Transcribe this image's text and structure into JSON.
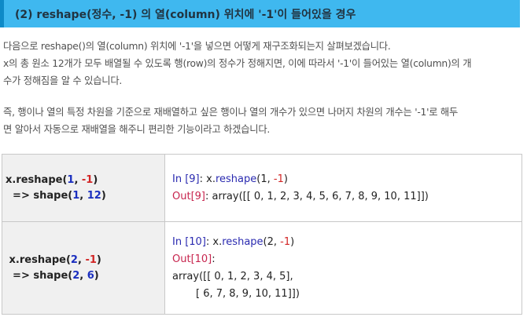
{
  "heading": "(2) reshape(정수, -1) 의 열(column) 위치에 '-1'이 들어있을 경우",
  "paragraph1": {
    "line1": "다음으로 reshape()의 열(column) 위치에 '-1'을 넣으면 어떻게 재구조화되는지 살펴보겠습니다.",
    "line2": "x의 총 원소 12개가 모두 배열될 수 있도록 행(row)의 정수가 정해지면, 이에 따라서 '-1'이 들어있는 열(column)의 개",
    "line3": "수가 정해짐을 알 수 있습니다."
  },
  "paragraph2": {
    "line1": "즉, 행이나 열의 특정 차원을 기준으로 재배열하고 싶은 행이나 열의 개수가 있으면 나머지 차원의 개수는 '-1'로 해두",
    "line2": "면 알아서 자동으로 재배열을 해주니 편리한 기능이라고 하겠습니다."
  },
  "rows": [
    {
      "left": {
        "call_prefix": "x.reshape(",
        "arg1": "1",
        "sep": ", ",
        "arg2": "-1",
        "close": ")",
        "arrow": " => shape(",
        "shape1": "1",
        "shape_sep": ", ",
        "shape2": "12",
        "shape_close": ")"
      },
      "right": {
        "in_label": "In [9]",
        "colon": ": ",
        "obj": "x.",
        "method": "reshape",
        "args_open": "(1, ",
        "neg": "-1",
        "args_close": ")",
        "out_label": "Out[9]",
        "out_text": ": array([[ 0,  1,  2,  3,  4,  5,  6,  7,  8,  9, 10, 11]])"
      }
    },
    {
      "left": {
        "call_prefix": "x.reshape(",
        "arg1": "2",
        "sep": ", ",
        "arg2": "-1",
        "close": ")",
        "arrow": " => shape(",
        "shape1": "2",
        "shape_sep": ", ",
        "shape2": "6",
        "shape_close": ")"
      },
      "right": {
        "in_label": "In [10]",
        "colon": ": ",
        "obj": "x.",
        "method": "reshape",
        "args_open": "(2, ",
        "neg": "-1",
        "args_close": ")",
        "out_label": "Out[10]",
        "out_colon": ":",
        "out_line1": "array([[ 0,  1,  2,  3,  4,  5],",
        "out_line2": "[ 6,  7,  8,  9, 10, 11]])"
      }
    }
  ]
}
